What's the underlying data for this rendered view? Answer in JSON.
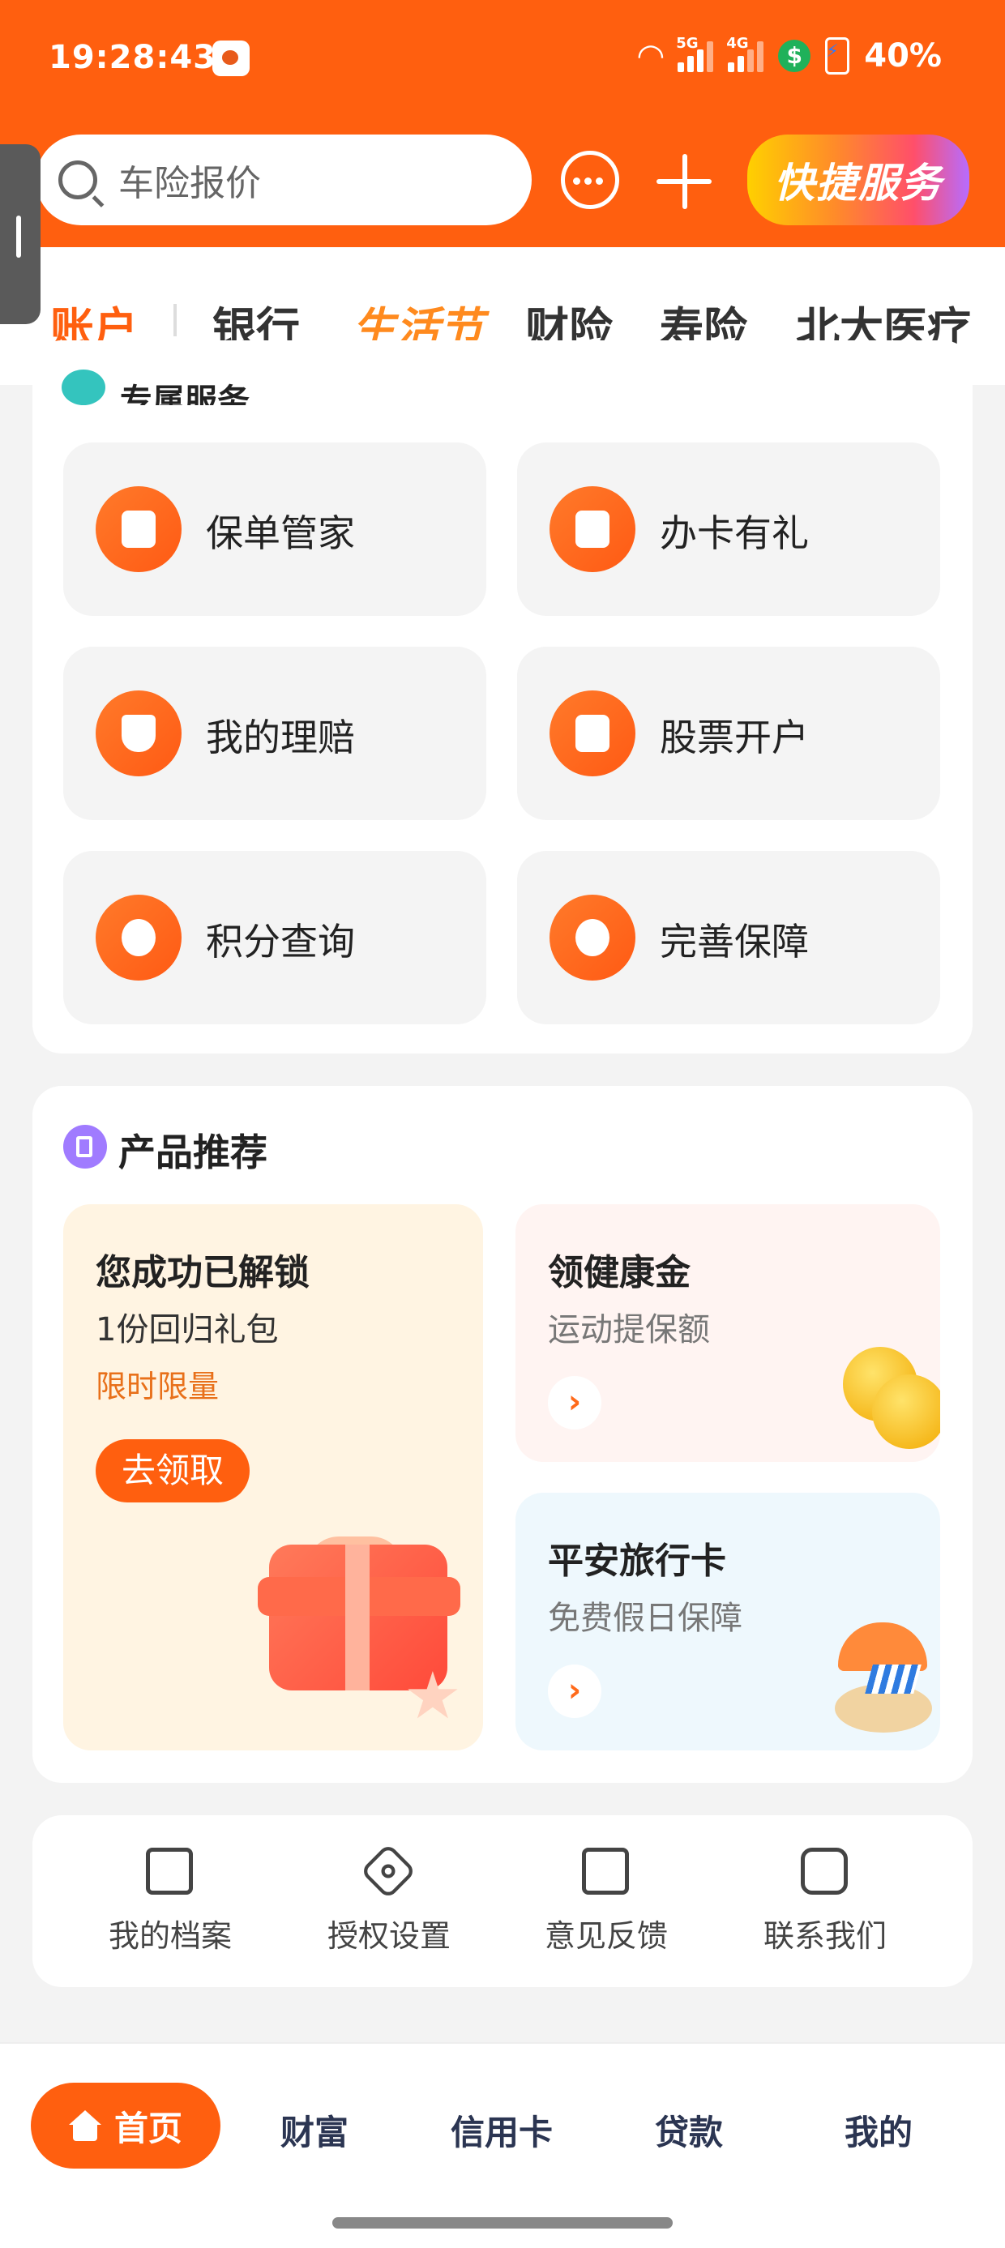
{
  "status_bar": {
    "time": "19:28:43",
    "net1": "5G",
    "net2": "4G",
    "battery": "40%",
    "money_symbol": "$"
  },
  "header": {
    "search_placeholder": "车险报价",
    "quick_service": "快捷服务"
  },
  "tabs": [
    {
      "label": "账户",
      "active": true
    },
    {
      "label": "银行"
    },
    {
      "label": "生活节"
    },
    {
      "label": "财险"
    },
    {
      "label": "寿险"
    },
    {
      "label": "北大医疗"
    }
  ],
  "services": {
    "title": "专属服务",
    "items": [
      {
        "label": "保单管家",
        "icon": "policy-icon"
      },
      {
        "label": "办卡有礼",
        "icon": "gift-card-icon"
      },
      {
        "label": "我的理赔",
        "icon": "shield-check-icon"
      },
      {
        "label": "股票开户",
        "icon": "receipt-icon"
      },
      {
        "label": "积分查询",
        "icon": "points-search-icon"
      },
      {
        "label": "完善保障",
        "icon": "health-check-icon"
      }
    ]
  },
  "products": {
    "title": "产品推荐",
    "gift": {
      "line1": "您成功已解锁",
      "line2": "1份回归礼包",
      "line3": "限时限量",
      "button": "去领取"
    },
    "health": {
      "title": "领健康金",
      "subtitle": "运动提保额",
      "arrow": "›"
    },
    "travel": {
      "title": "平安旅行卡",
      "subtitle": "免费假日保障",
      "arrow": "›"
    }
  },
  "tools": [
    {
      "label": "我的档案",
      "icon": "profile-file-icon"
    },
    {
      "label": "授权设置",
      "icon": "settings-hex-icon"
    },
    {
      "label": "意见反馈",
      "icon": "feedback-edit-icon"
    },
    {
      "label": "联系我们",
      "icon": "contact-book-icon"
    }
  ],
  "bottom_nav": [
    {
      "label": "首页",
      "active": true
    },
    {
      "label": "财富"
    },
    {
      "label": "信用卡"
    },
    {
      "label": "贷款"
    },
    {
      "label": "我的"
    }
  ],
  "colors": {
    "brand": "#ff5f0f"
  }
}
